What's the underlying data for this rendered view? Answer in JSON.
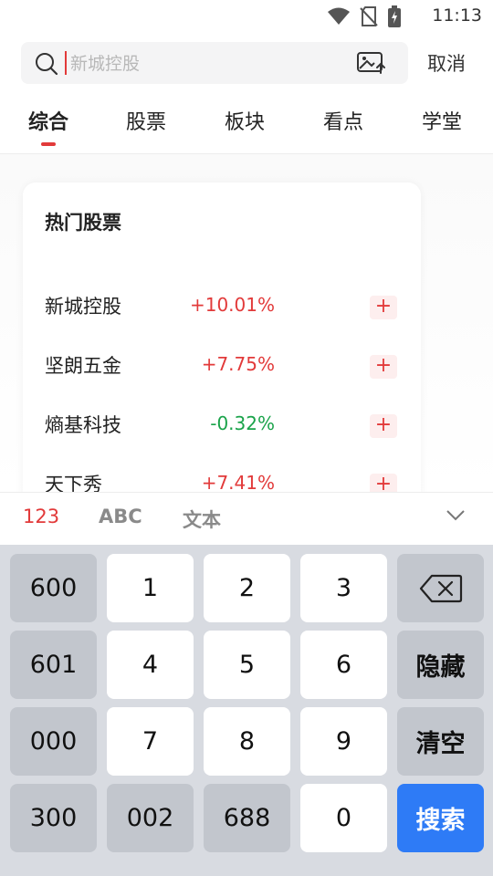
{
  "status_bar": {
    "time": "11:13"
  },
  "search": {
    "placeholder": "新城控股",
    "cancel_label": "取消"
  },
  "tabs": [
    {
      "label": "综合"
    },
    {
      "label": "股票"
    },
    {
      "label": "板块"
    },
    {
      "label": "看点"
    },
    {
      "label": "学堂"
    }
  ],
  "hot": {
    "title": "热门股票",
    "stocks": [
      {
        "name": "新城控股",
        "change": "+10.01%",
        "direction": "up"
      },
      {
        "name": "坚朗五金",
        "change": "+7.75%",
        "direction": "up"
      },
      {
        "name": "熵基科技",
        "change": "-0.32%",
        "direction": "down"
      },
      {
        "name": "天下秀",
        "change": "+7.41%",
        "direction": "up"
      }
    ],
    "add_label": "+"
  },
  "keyboard_modes": [
    "123",
    "ABC",
    "文本"
  ],
  "keyboard": {
    "side_left": [
      "600",
      "601",
      "000",
      "300"
    ],
    "digits": [
      "1",
      "2",
      "3",
      "4",
      "5",
      "6",
      "7",
      "8",
      "9",
      "002",
      "688",
      "0"
    ],
    "hide": "隐藏",
    "clear": "清空",
    "search": "搜索"
  },
  "colors": {
    "up": "#e23a3a",
    "down": "#1aa34a",
    "accent": "#e23a3a",
    "search_key": "#2e7bf6"
  }
}
